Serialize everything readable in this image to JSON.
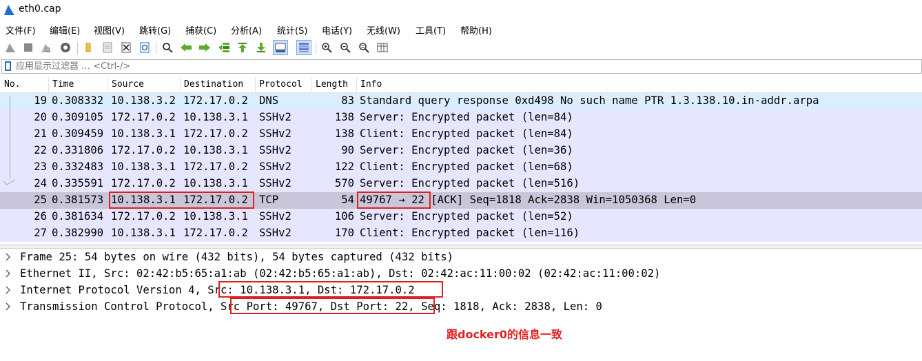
{
  "window": {
    "title": "eth0.cap"
  },
  "menu": [
    "文件(F)",
    "编辑(E)",
    "视图(V)",
    "跳转(G)",
    "捕获(C)",
    "分析(A)",
    "统计(S)",
    "电话(Y)",
    "无线(W)",
    "工具(T)",
    "帮助(H)"
  ],
  "toolbar": {
    "icons": [
      "shark-fin-start-icon",
      "stop-square-icon",
      "restart-fin-icon",
      "capture-options-gear-icon",
      "open-folder-icon",
      "save-file-icon",
      "close-file-icon",
      "reload-file-icon",
      "find-magnifier-icon",
      "go-back-arrow-icon",
      "go-forward-arrow-icon",
      "go-to-packet-icon",
      "go-first-packet-icon",
      "go-last-packet-icon",
      "autoscroll-icon",
      "colorize-icon",
      "zoom-in-icon",
      "zoom-out-icon",
      "zoom-normal-icon",
      "resize-columns-icon"
    ]
  },
  "filter": {
    "placeholder": "应用显示过滤器 … <Ctrl-/>"
  },
  "packet_list": {
    "columns": [
      "No.",
      "Time",
      "Source",
      "Destination",
      "Protocol",
      "Length",
      "Info"
    ],
    "rows": [
      {
        "no": "19",
        "time": "0.308332",
        "src": "10.138.3.2",
        "dst": "172.17.0.2",
        "proto": "DNS",
        "len": "83",
        "info": "Standard query response 0xd498 No such name PTR 1.3.138.10.in-addr.arpa"
      },
      {
        "no": "20",
        "time": "0.309105",
        "src": "172.17.0.2",
        "dst": "10.138.3.1",
        "proto": "SSHv2",
        "len": "138",
        "info": "Server: Encrypted packet (len=84)"
      },
      {
        "no": "21",
        "time": "0.309459",
        "src": "10.138.3.1",
        "dst": "172.17.0.2",
        "proto": "SSHv2",
        "len": "138",
        "info": "Client: Encrypted packet (len=84)"
      },
      {
        "no": "22",
        "time": "0.331806",
        "src": "172.17.0.2",
        "dst": "10.138.3.1",
        "proto": "SSHv2",
        "len": "90",
        "info": "Server: Encrypted packet (len=36)"
      },
      {
        "no": "23",
        "time": "0.332483",
        "src": "10.138.3.1",
        "dst": "172.17.0.2",
        "proto": "SSHv2",
        "len": "122",
        "info": "Client: Encrypted packet (len=68)"
      },
      {
        "no": "24",
        "time": "0.335591",
        "src": "172.17.0.2",
        "dst": "10.138.3.1",
        "proto": "SSHv2",
        "len": "570",
        "info": "Server: Encrypted packet (len=516)"
      },
      {
        "no": "25",
        "time": "0.381573",
        "src": "10.138.3.1",
        "dst": "172.17.0.2",
        "proto": "TCP",
        "len": "54",
        "info": "49767 → 22 [ACK] Seq=1818 Ack=2838 Win=1050368 Len=0"
      },
      {
        "no": "26",
        "time": "0.381634",
        "src": "172.17.0.2",
        "dst": "10.138.3.1",
        "proto": "SSHv2",
        "len": "106",
        "info": "Server: Encrypted packet (len=52)"
      },
      {
        "no": "27",
        "time": "0.382990",
        "src": "10.138.3.1",
        "dst": "172.17.0.2",
        "proto": "SSHv2",
        "len": "170",
        "info": "Client: Encrypted packet (len=116)"
      }
    ]
  },
  "details": [
    "Frame 25: 54 bytes on wire (432 bits), 54 bytes captured (432 bits)",
    "Ethernet II, Src: 02:42:b5:65:a1:ab (02:42:b5:65:a1:ab), Dst: 02:42:ac:11:00:02 (02:42:ac:11:00:02)",
    "Internet Protocol Version 4, Src: 10.138.3.1, Dst: 172.17.0.2",
    "Transmission Control Protocol, Src Port: 49767, Dst Port: 22, Seq: 1818, Ack: 2838, Len: 0"
  ],
  "annotation": "跟docker0的信息一致",
  "colors": {
    "accent": "#e02020",
    "row_ssh": "#e7e6ff",
    "row_dns": "#daeeff",
    "row_selected": "#c8c6d8"
  }
}
